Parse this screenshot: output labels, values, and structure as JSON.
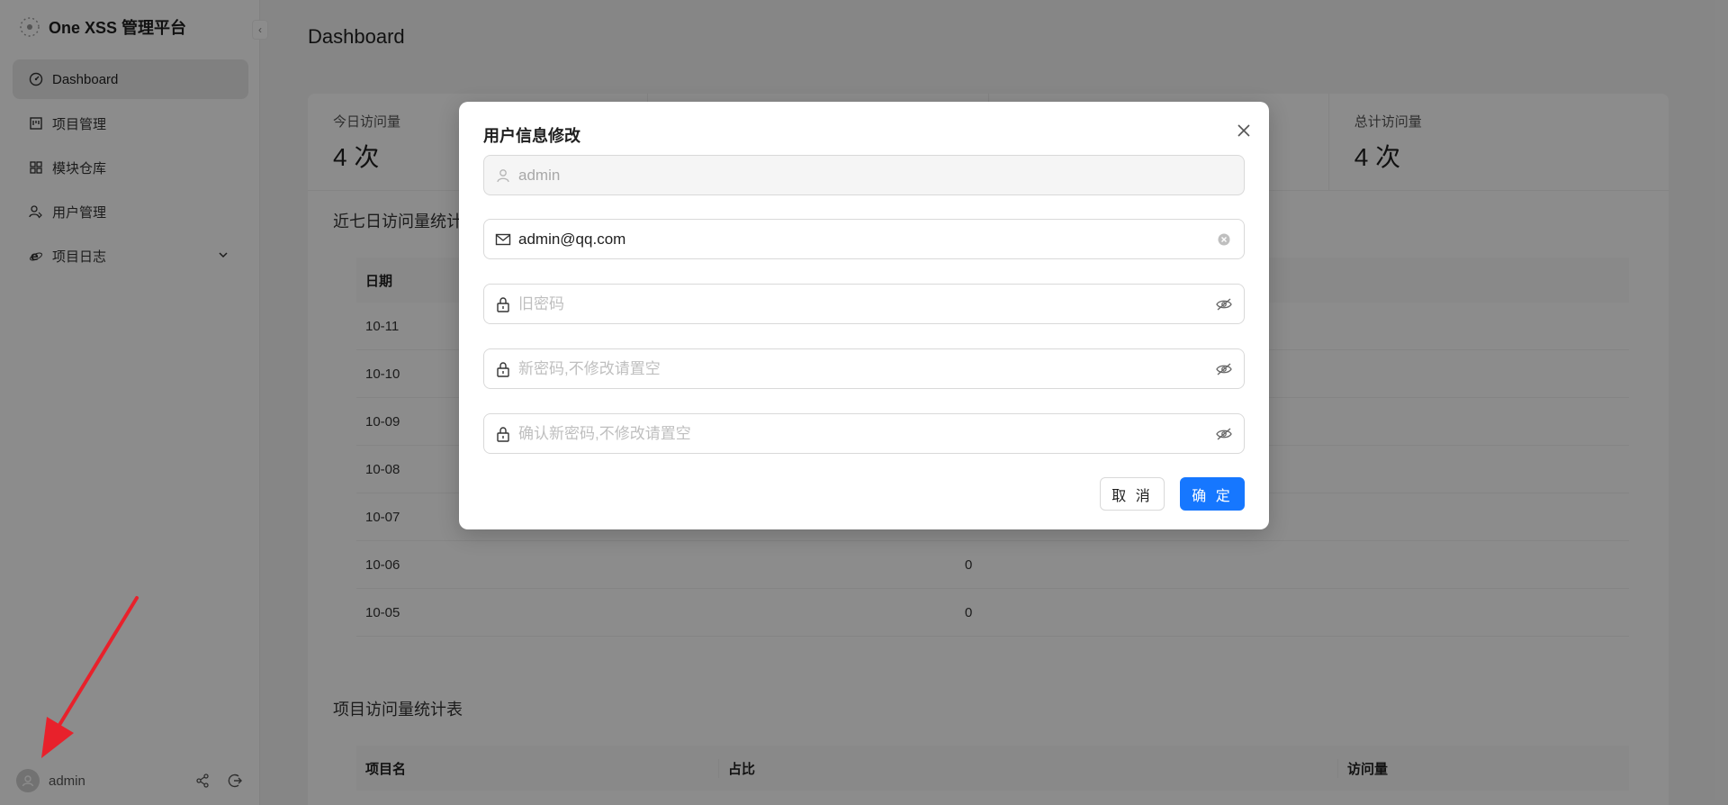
{
  "app": {
    "brand_title": "One XSS 管理平台",
    "collapse_icon": "chevron-left-icon"
  },
  "sidebar": {
    "items": [
      {
        "label": "Dashboard",
        "icon": "dashboard-icon",
        "active": true
      },
      {
        "label": "项目管理",
        "icon": "project-icon"
      },
      {
        "label": "模块仓库",
        "icon": "module-icon"
      },
      {
        "label": "用户管理",
        "icon": "users-icon"
      },
      {
        "label": "项目日志",
        "icon": "ie-icon",
        "has_submenu": true
      }
    ],
    "footer": {
      "username": "admin",
      "share_icon": "share-icon",
      "logout_icon": "logout-icon"
    }
  },
  "main": {
    "page_title": "Dashboard",
    "stats": [
      {
        "label": "今日访问量",
        "value": "4 次"
      },
      {
        "label": "",
        "value": ""
      },
      {
        "label": "",
        "value": ""
      },
      {
        "label": "总计访问量",
        "value": "4 次"
      }
    ],
    "week_section_title": "近七日访问量统计",
    "week_table": {
      "headers": [
        "日期",
        ""
      ],
      "rows": [
        [
          "10-11",
          ""
        ],
        [
          "10-10",
          ""
        ],
        [
          "10-09",
          ""
        ],
        [
          "10-08",
          ""
        ],
        [
          "10-07",
          ""
        ],
        [
          "10-06",
          "0"
        ],
        [
          "10-05",
          "0"
        ]
      ]
    },
    "project_section_title": "项目访问量统计表",
    "project_table": {
      "headers": [
        "项目名",
        "占比",
        "访问量"
      ]
    }
  },
  "modal": {
    "title": "用户信息修改",
    "username_value": "admin",
    "email_value": "admin@qq.com",
    "old_password_placeholder": "旧密码",
    "new_password_placeholder": "新密码,不修改请置空",
    "confirm_password_placeholder": "确认新密码,不修改请置空",
    "cancel_label": "取 消",
    "ok_label": "确 定"
  },
  "colors": {
    "primary": "#1677ff",
    "annotation_arrow": "#e8212b"
  }
}
